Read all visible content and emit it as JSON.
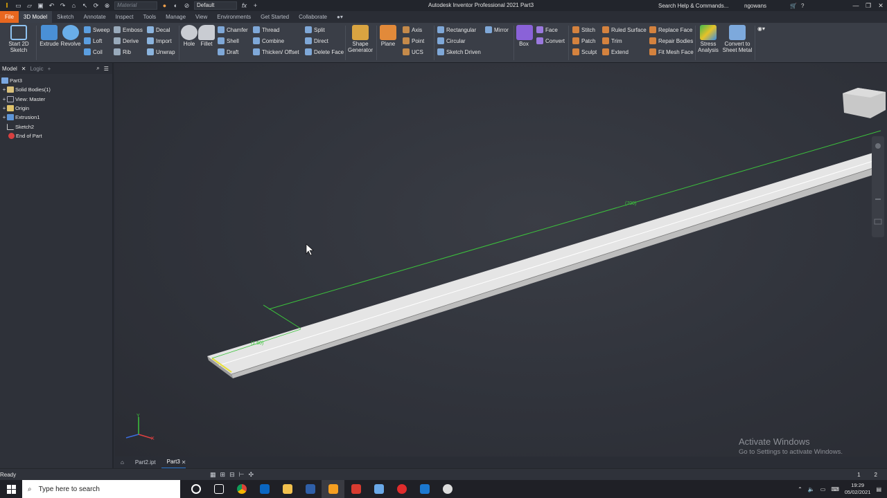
{
  "titlebar": {
    "material_placeholder": "Material",
    "appearance": "Default",
    "title": "Autodesk Inventor Professional 2021   Part3",
    "search_help": "Search Help & Commands...",
    "username": "ngowans"
  },
  "menu_tabs": [
    "File",
    "3D Model",
    "Sketch",
    "Annotate",
    "Inspect",
    "Tools",
    "Manage",
    "View",
    "Environments",
    "Get Started",
    "Collaborate"
  ],
  "ribbon": {
    "start_sketch": "Start 2D Sketch",
    "extrude": "Extrude",
    "revolve": "Revolve",
    "sweep": "Sweep",
    "loft": "Loft",
    "coil": "Coil",
    "emboss": "Emboss",
    "derive": "Derive",
    "rib": "Rib",
    "decal": "Decal",
    "import": "Import",
    "unwrap": "Unwrap",
    "hole": "Hole",
    "fillet": "Fillet",
    "chamfer": "Chamfer",
    "shell": "Shell",
    "draft": "Draft",
    "thread": "Thread",
    "combine": "Combine",
    "thicken_offset": "Thicken/ Offset",
    "split": "Split",
    "direct": "Direct",
    "delete_face": "Delete Face",
    "shape_generator": "Shape Generator",
    "plane": "Plane",
    "axis": "Axis",
    "point": "Point",
    "ucs": "UCS",
    "rectangular": "Rectangular",
    "circular": "Circular",
    "sketch_driven": "Sketch Driven",
    "mirror": "Mirror",
    "box": "Box",
    "face": "Face",
    "convert": "Convert",
    "stitch": "Stitch",
    "patch": "Patch",
    "sculpt": "Sculpt",
    "ruled_surface": "Ruled Surface",
    "trim": "Trim",
    "extend": "Extend",
    "replace_face": "Replace Face",
    "repair_bodies": "Repair Bodies",
    "fit_mesh_face": "Fit Mesh Face",
    "stress_analysis": "Stress Analysis",
    "convert_sheet_metal": "Convert to Sheet Metal"
  },
  "browser": {
    "tab_model": "Model",
    "tab_logic": "Logic",
    "tree": [
      {
        "label": "Part3",
        "expander": ""
      },
      {
        "label": "Solid Bodies(1)",
        "expander": "+"
      },
      {
        "label": "View: Master",
        "expander": "+"
      },
      {
        "label": "Origin",
        "expander": "+"
      },
      {
        "label": "Extrusion1",
        "expander": "+"
      },
      {
        "label": "Sketch2",
        "expander": ""
      },
      {
        "label": "End of Part",
        "expander": ""
      }
    ]
  },
  "viewport": {
    "dimension_long": "(700)",
    "dimension_short": "(1.50)",
    "watermark_title": "Activate Windows",
    "watermark_sub": "Go to Settings to activate Windows."
  },
  "doc_tabs": [
    "Part2.ipt",
    "Part3"
  ],
  "status": {
    "text": "Ready",
    "num1": "1",
    "num2": "2"
  },
  "taskbar": {
    "search_placeholder": "Type here to search",
    "time": "19:29",
    "date": "05/02/2021"
  },
  "colors": {
    "file_tab": "#e8671f",
    "dimension_green": "#3cc43c",
    "viewport_bg": "#30333b"
  }
}
